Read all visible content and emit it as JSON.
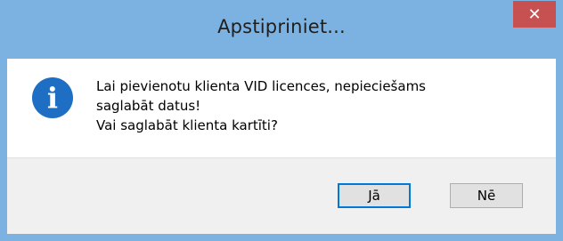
{
  "window": {
    "title": "Apstipriniet...",
    "close_symbol": "✕"
  },
  "message": {
    "icon": "info-icon",
    "lines": [
      "Lai pievienotu klienta VID licences, nepieciešams",
      "saglabāt datus!",
      "Vai saglabāt klienta kartīti?"
    ]
  },
  "buttons": {
    "yes_label": "Jā",
    "no_label": "Nē"
  },
  "colors": {
    "frame": "#7cb2e2",
    "close_button": "#c75050",
    "info_icon": "#1e6fc4",
    "default_button_border": "#0078d7"
  }
}
